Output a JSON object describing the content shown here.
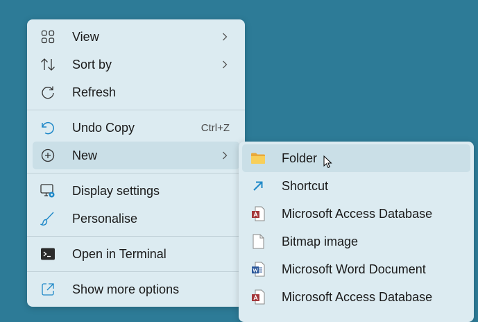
{
  "main_menu": {
    "items": [
      {
        "label": "View",
        "icon": "grid-icon",
        "has_submenu": true
      },
      {
        "label": "Sort by",
        "icon": "sort-icon",
        "has_submenu": true
      },
      {
        "label": "Refresh",
        "icon": "refresh-icon"
      },
      {
        "label": "Undo Copy",
        "icon": "undo-icon",
        "shortcut": "Ctrl+Z"
      },
      {
        "label": "New",
        "icon": "plus-circle-icon",
        "has_submenu": true,
        "highlighted": true
      },
      {
        "label": "Display settings",
        "icon": "display-settings-icon"
      },
      {
        "label": "Personalise",
        "icon": "brush-icon"
      },
      {
        "label": "Open in Terminal",
        "icon": "terminal-icon"
      },
      {
        "label": "Show more options",
        "icon": "open-external-icon"
      }
    ]
  },
  "new_submenu": {
    "items": [
      {
        "label": "Folder",
        "icon": "folder-icon",
        "highlighted": true
      },
      {
        "label": "Shortcut",
        "icon": "shortcut-arrow-icon"
      },
      {
        "label": "Microsoft Access Database",
        "icon": "access-file-icon"
      },
      {
        "label": "Bitmap image",
        "icon": "blank-file-icon"
      },
      {
        "label": "Microsoft Word Document",
        "icon": "word-file-icon"
      },
      {
        "label": "Microsoft Access Database",
        "icon": "access-file-icon"
      }
    ]
  },
  "colors": {
    "desktop": "#2d7b97",
    "menu_bg": "#dcebf1",
    "hover_bg": "#cadfe7",
    "accent": "#1e88c8"
  }
}
